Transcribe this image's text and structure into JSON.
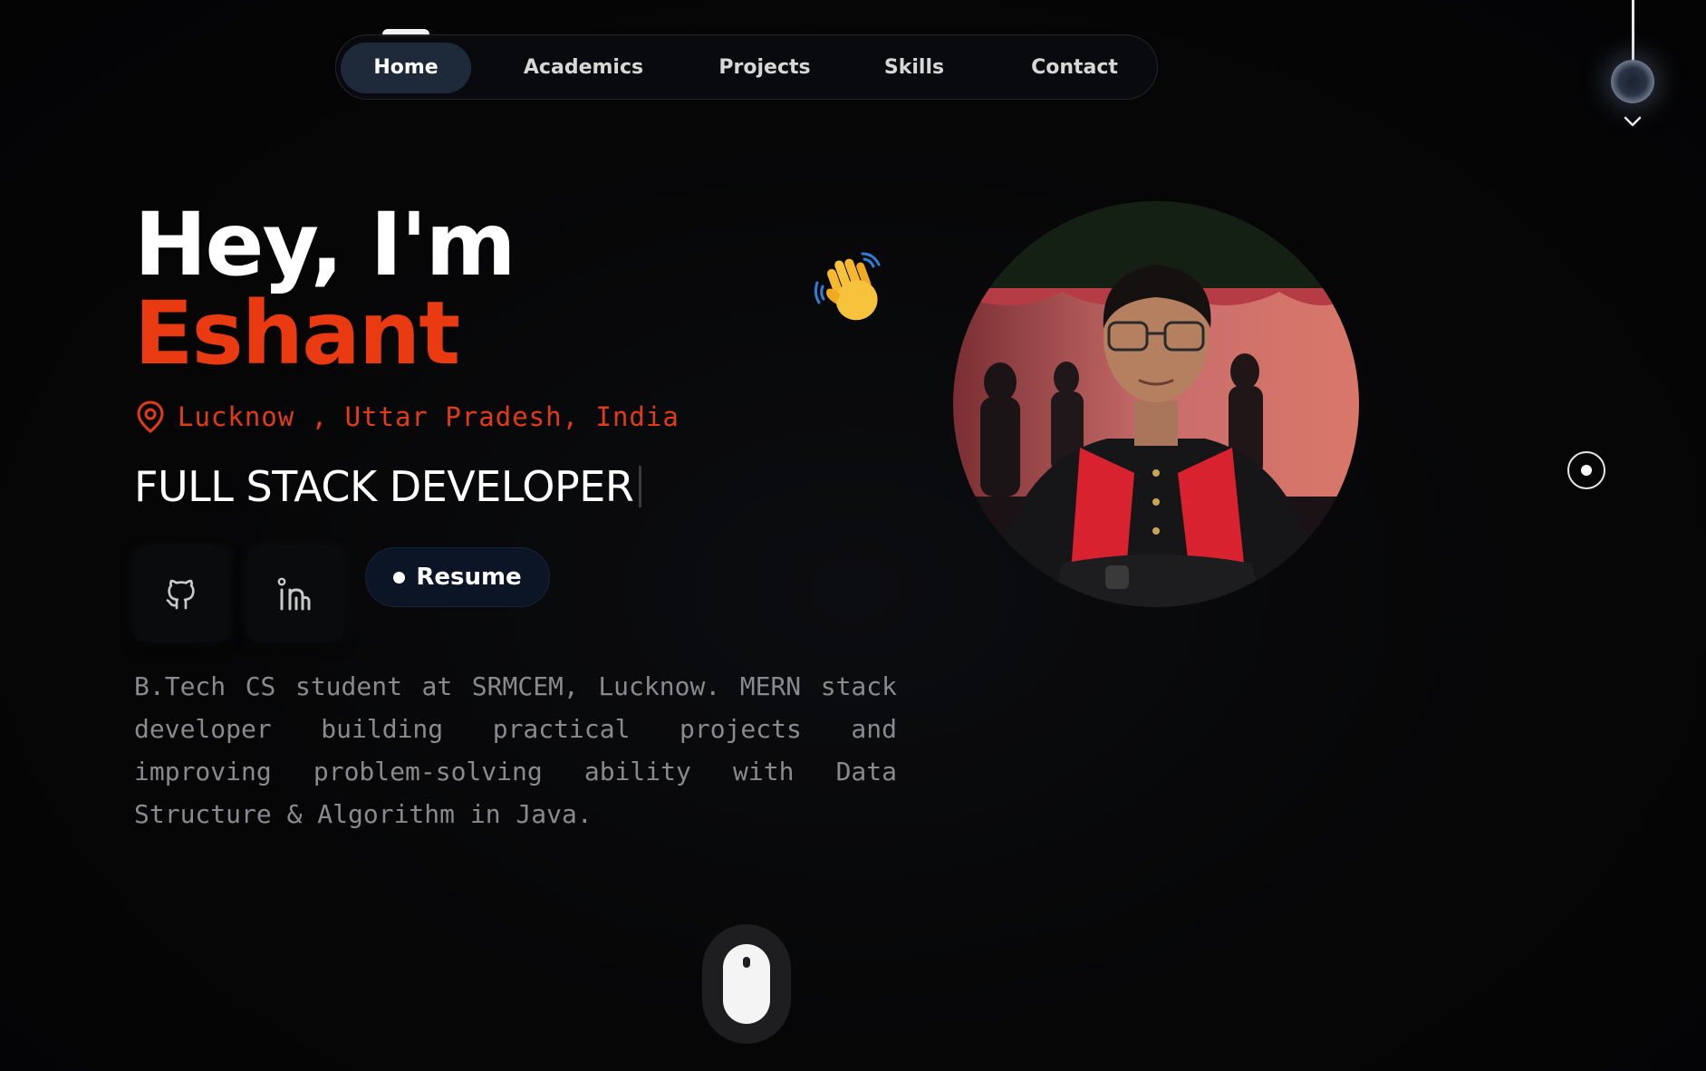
{
  "nav": {
    "items": [
      {
        "label": "Home",
        "active": true
      },
      {
        "label": "Academics",
        "active": false
      },
      {
        "label": "Projects",
        "active": false
      },
      {
        "label": "Skills",
        "active": false
      },
      {
        "label": "Contact",
        "active": false
      }
    ]
  },
  "hero": {
    "greeting": "Hey, I'm",
    "name": "Eshant",
    "location": "Lucknow , Uttar Pradesh, India",
    "role": "FULL STACK DEVELOPER",
    "resume_label": "Resume",
    "bio": "B.Tech CS student at SRMCEM, Lucknow. MERN stack developer building practical projects and improving problem-solving ability with Data Structure & Algorithm in Java."
  },
  "icons": {
    "github": "github-icon",
    "linkedin": "linkedin-icon",
    "location": "map-pin-icon",
    "wave": "waving-hand-icon",
    "theme_lamp": "lamp-icon",
    "scroll": "mouse-scroll-icon"
  },
  "colors": {
    "accent": "#ea3a11",
    "background": "#050506",
    "nav_active": "#1e2a3a"
  }
}
